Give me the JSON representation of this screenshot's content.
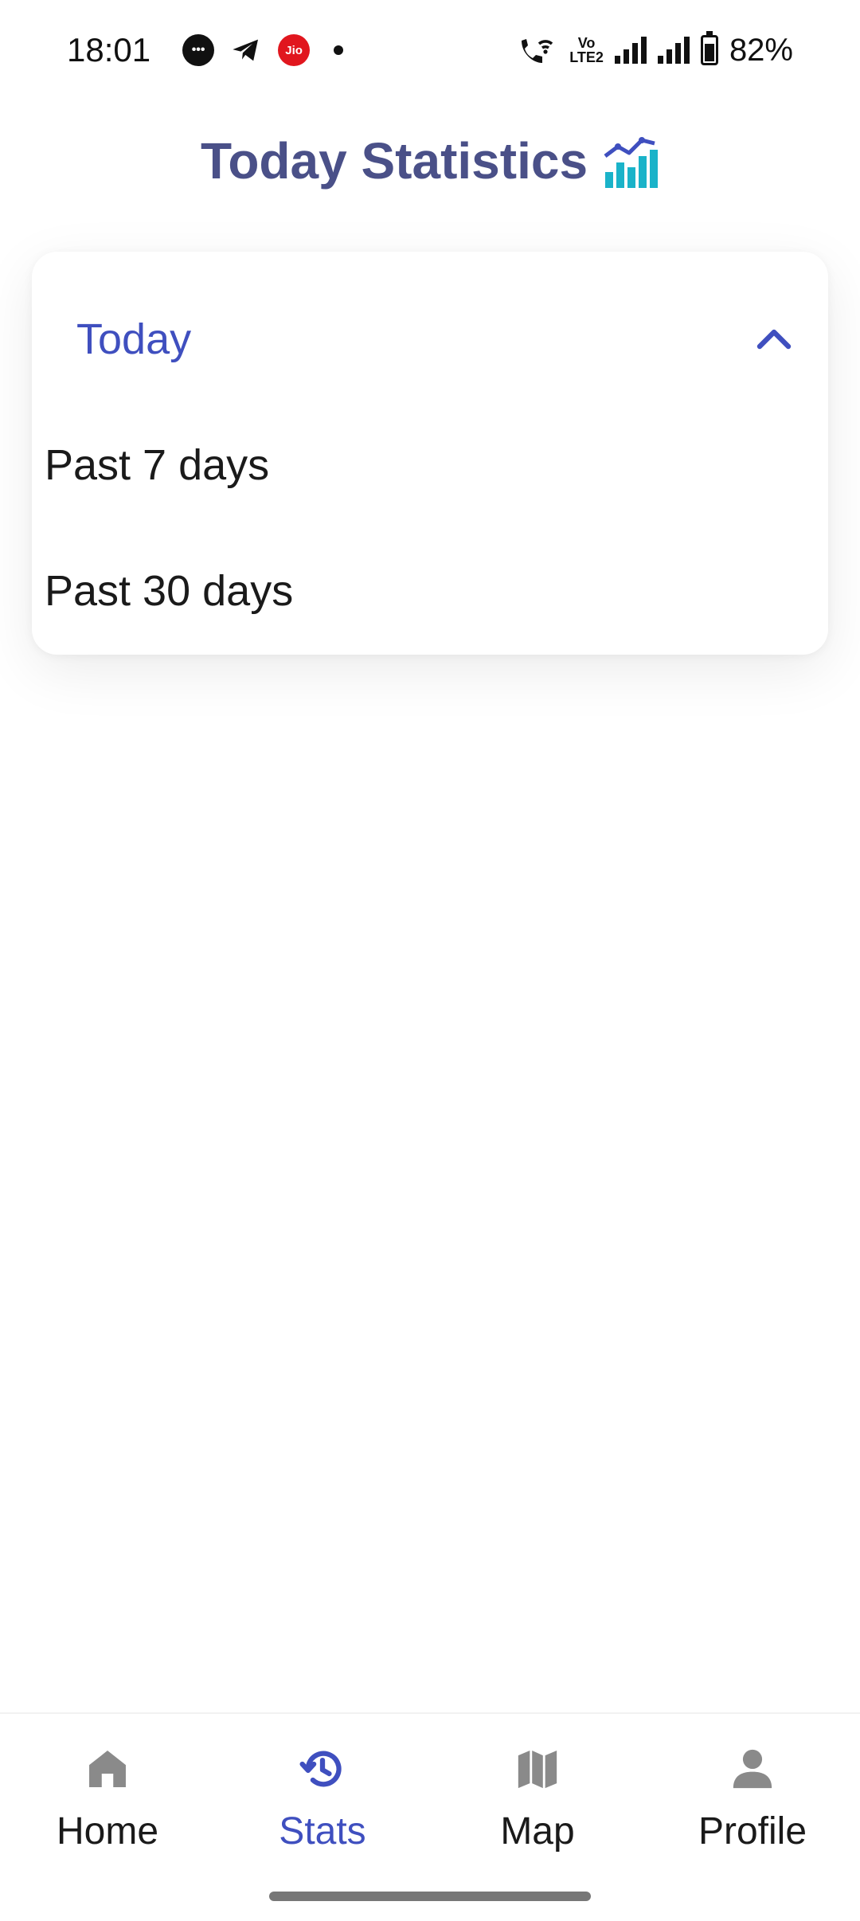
{
  "status_bar": {
    "time": "18:01",
    "notification_icons": [
      "chat-icon",
      "telegram-icon",
      "jio-icon",
      "dot-icon"
    ],
    "jio_text": "Jio",
    "volte_top": "Vo",
    "volte_bottom": "LTE2",
    "battery": "82%"
  },
  "header": {
    "title": "Today Statistics",
    "icon": "chart-icon"
  },
  "dropdown": {
    "selected": "Today",
    "expanded": true,
    "options": [
      "Past 7 days",
      "Past 30 days"
    ]
  },
  "bottom_nav": {
    "items": [
      {
        "label": "Home",
        "icon": "home-icon",
        "active": false
      },
      {
        "label": "Stats",
        "icon": "history-icon",
        "active": true
      },
      {
        "label": "Map",
        "icon": "map-icon",
        "active": false
      },
      {
        "label": "Profile",
        "icon": "person-icon",
        "active": false
      }
    ]
  },
  "colors": {
    "accent": "#3f4fbf",
    "title": "#4a5088",
    "inactive_icon": "#8a8a8a",
    "chart_teal": "#1ab3c9"
  }
}
